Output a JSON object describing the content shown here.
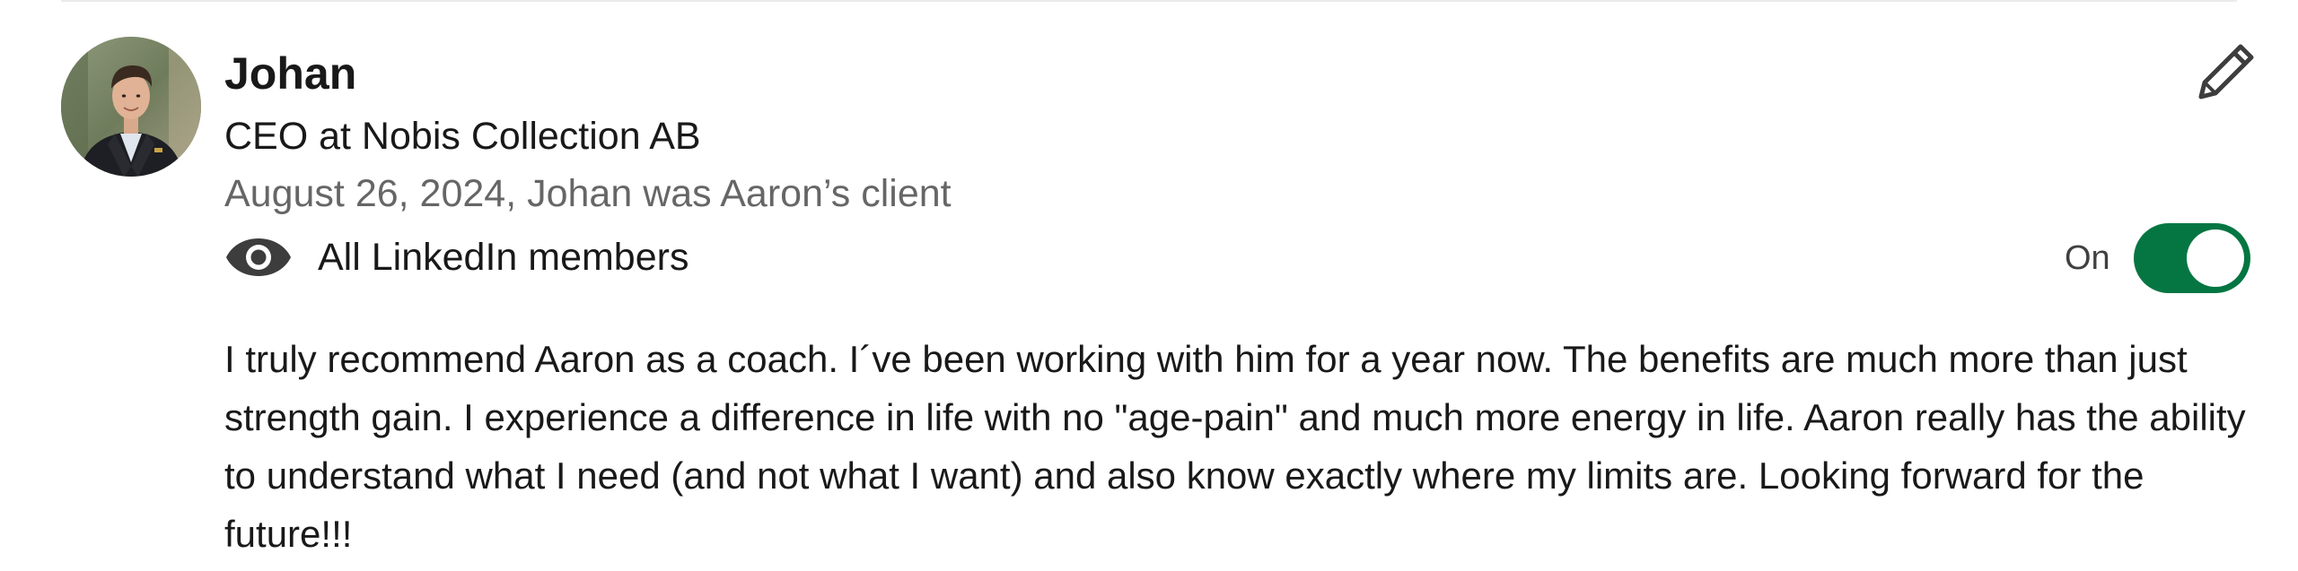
{
  "recommendation": {
    "name": "Johan",
    "headline": "CEO at Nobis Collection AB",
    "meta": "August 26, 2024, Johan was Aaron’s client",
    "visibility_label": "All LinkedIn members",
    "visibility_icon": "eye-icon",
    "toggle_label": "On",
    "toggle_on": true,
    "accent_color": "#057642",
    "edit_icon": "pencil-icon",
    "text": "I truly recommend Aaron as a coach. I´ve been working with him for a year now. The benefits are much more than just strength gain. I experience a difference in life with no \"age-pain\" and much more energy in life. Aaron really has the ability to understand what I need (and not what I want) and also know exactly where my limits are. Looking forward for the future!!!"
  }
}
